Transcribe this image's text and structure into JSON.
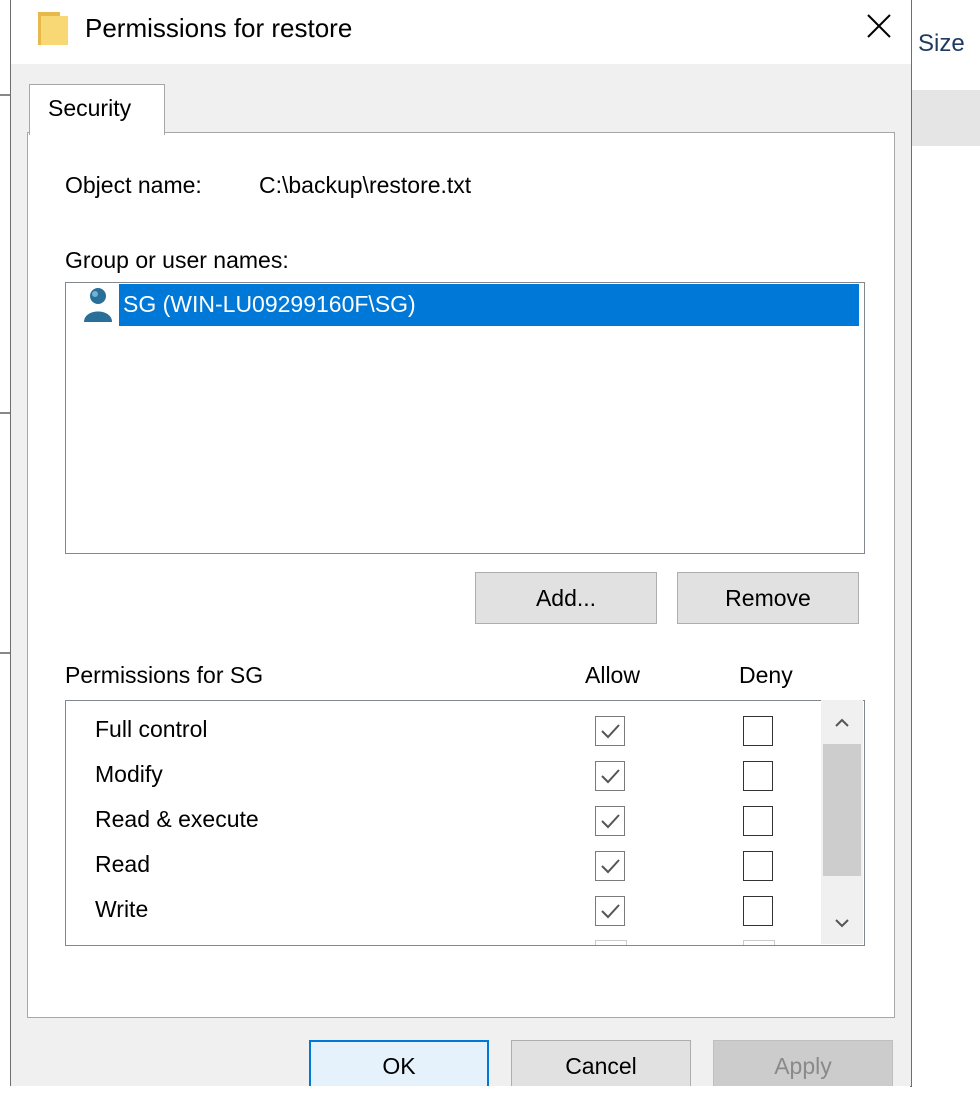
{
  "background": {
    "column_header": "Size"
  },
  "dialog": {
    "title": "Permissions for restore",
    "tab_label": "Security",
    "object_name_label": "Object name:",
    "object_name_value": "C:\\backup\\restore.txt",
    "group_label": "Group or user names:",
    "users": [
      {
        "name": "SG (WIN-LU09299160F\\SG)",
        "selected": true
      }
    ],
    "add_button": "Add...",
    "remove_button": "Remove",
    "permissions_label": "Permissions for SG",
    "allow_header": "Allow",
    "deny_header": "Deny",
    "permissions": [
      {
        "name": "Full control",
        "allow": true,
        "deny": false
      },
      {
        "name": "Modify",
        "allow": true,
        "deny": false
      },
      {
        "name": "Read & execute",
        "allow": true,
        "deny": false
      },
      {
        "name": "Read",
        "allow": true,
        "deny": false
      },
      {
        "name": "Write",
        "allow": true,
        "deny": false
      }
    ],
    "ok_button": "OK",
    "cancel_button": "Cancel",
    "apply_button": "Apply"
  },
  "colors": {
    "selection": "#0078d7",
    "folder_icon": "#f8d775",
    "user_icon": "#2a6f97",
    "ok_border": "#0078d7"
  }
}
